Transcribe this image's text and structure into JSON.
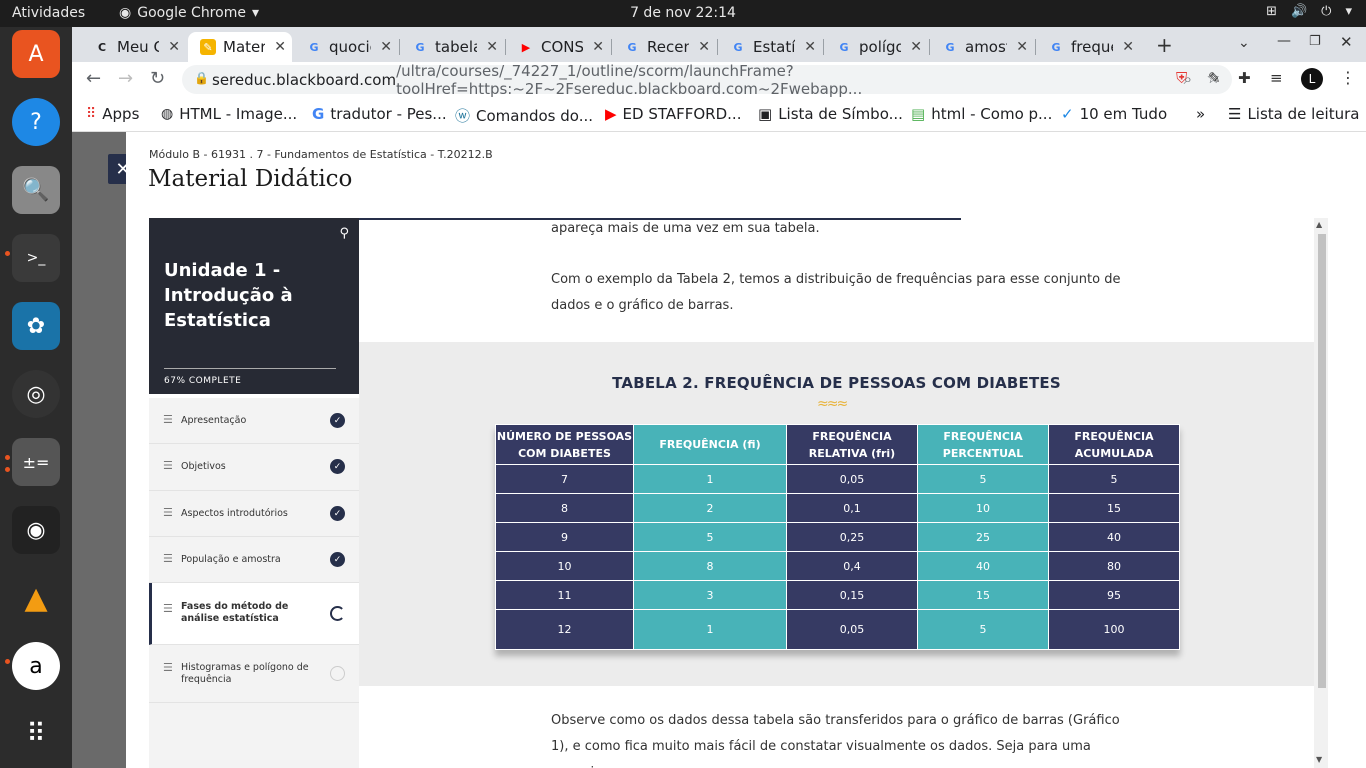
{
  "topbar": {
    "activities": "Atividades",
    "app": "Google Chrome",
    "clock": "7 de nov  22:14"
  },
  "tabs": [
    {
      "title": "Meu C",
      "icon": "C",
      "color": "#ffffff"
    },
    {
      "title": "Mater",
      "icon": "✎",
      "color": "#f5b400"
    },
    {
      "title": "quocie",
      "icon": "G",
      "color": "#ffffff"
    },
    {
      "title": "tabela",
      "icon": "G",
      "color": "#ffffff"
    },
    {
      "title": "CONS",
      "icon": "▶",
      "color": "#ff0000"
    },
    {
      "title": "Recen",
      "icon": "G",
      "color": "#ffffff"
    },
    {
      "title": "Estatí",
      "icon": "G",
      "color": "#ffffff"
    },
    {
      "title": "polígo",
      "icon": "G",
      "color": "#ffffff"
    },
    {
      "title": "amost",
      "icon": "G",
      "color": "#ffffff"
    },
    {
      "title": "freque",
      "icon": "G",
      "color": "#ffffff"
    }
  ],
  "address": {
    "domain": "sereduc.blackboard.com",
    "path": "/ultra/courses/_74227_1/outline/scorm/launchFrame?toolHref=https:~2F~2Fsereduc.blackboard.com~2Fwebapp..."
  },
  "bookmarks": [
    "Apps",
    "HTML - Image...",
    "tradutor - Pes...",
    "Comandos do...",
    "ED STAFFORD...",
    "Lista de Símbo...",
    "html - Como p...",
    "10 em Tudo",
    "Lista de leitura"
  ],
  "header": {
    "breadcrumb": "Módulo B - 61931 . 7 - Fundamentos de Estatística - T.20212.B",
    "title": "Material Didático"
  },
  "hero": {
    "unit": "Unidade 1 - Introdução à Estatística",
    "progress": "67% COMPLETE"
  },
  "toc": [
    {
      "label": "Apresentação",
      "status": "done"
    },
    {
      "label": "Objetivos",
      "status": "done"
    },
    {
      "label": "Aspectos introdutórios",
      "status": "done"
    },
    {
      "label": "População e amostra",
      "status": "done"
    },
    {
      "label": "Fases do método de análise estatística",
      "status": "in-progress"
    },
    {
      "label": "Histogramas e polígono de frequência",
      "status": "todo"
    }
  ],
  "content": {
    "p1": "apareça mais de uma vez em sua tabela.",
    "p2": "Com o exemplo da Tabela 2, temos a distribuição de frequências para esse conjunto de dados e o gráfico de barras.",
    "p3": "Observe como os dados dessa tabela são transferidos para o gráfico de barras (Gráfico 1), e como fica muito mais fácil de constatar visualmente os dados. Seja para uma pesquisa"
  },
  "table": {
    "title": "TABELA 2. FREQUÊNCIA DE PESSOAS COM DIABETES",
    "headers": [
      "NÚMERO DE PESSOAS COM DIABETES",
      "FREQUÊNCIA (fi)",
      "FREQUÊNCIA RELATIVA (fri)",
      "FREQUÊNCIA PERCENTUAL",
      "FREQUÊNCIA ACUMULADA"
    ],
    "rows": [
      [
        "7",
        "1",
        "0,05",
        "5",
        "5"
      ],
      [
        "8",
        "2",
        "0,1",
        "10",
        "15"
      ],
      [
        "9",
        "5",
        "0,25",
        "25",
        "40"
      ],
      [
        "10",
        "8",
        "0,4",
        "40",
        "80"
      ],
      [
        "11",
        "3",
        "0,15",
        "15",
        "95"
      ],
      [
        "12",
        "1",
        "0,05",
        "5",
        "100"
      ]
    ]
  }
}
